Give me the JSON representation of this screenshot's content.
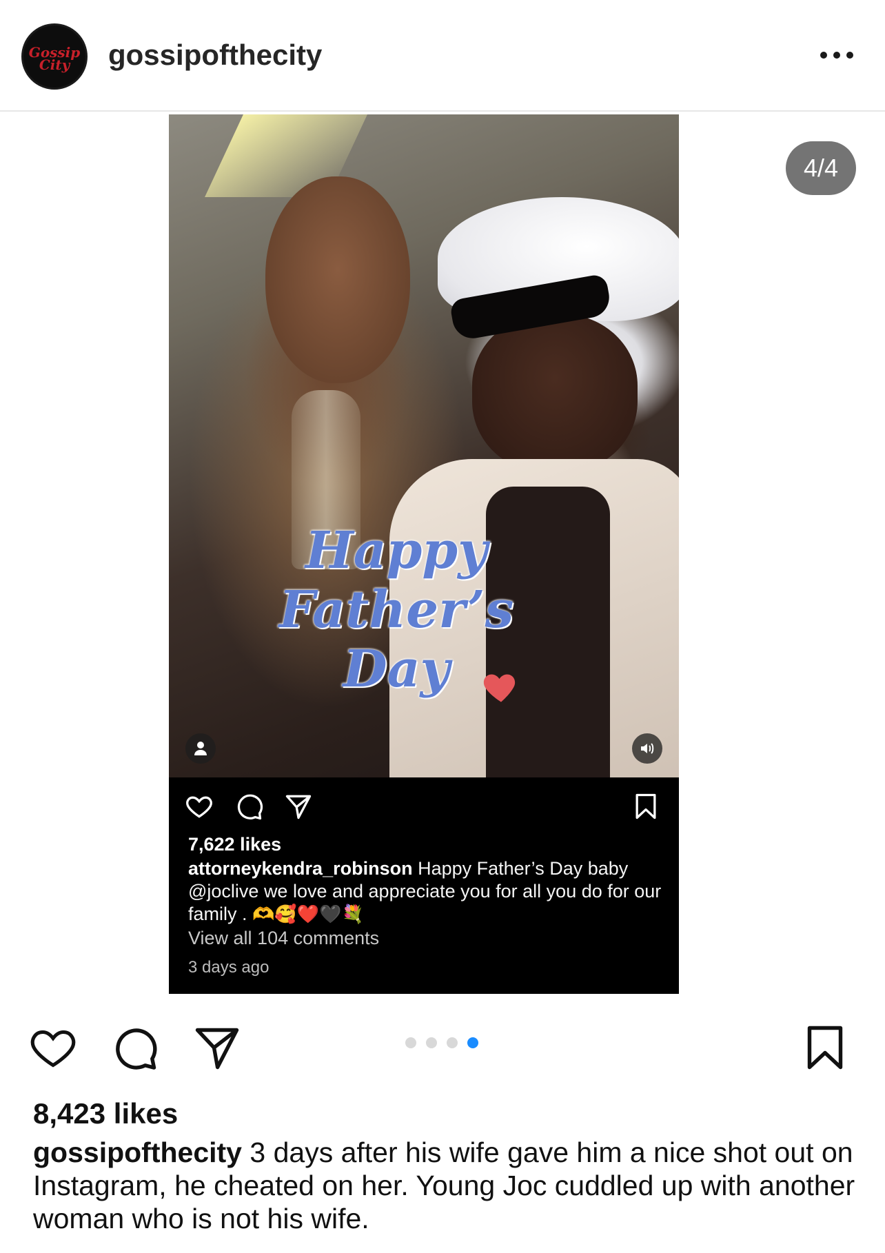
{
  "header": {
    "avatar_text": "Gossip City",
    "username": "gossipofthecity"
  },
  "media": {
    "counter": "4/4",
    "sticker": {
      "line1": "Happy",
      "line2": "Father’s",
      "line3": "Day"
    },
    "inner_post": {
      "likes": "7,622 likes",
      "username": "attorneykendra_robinson",
      "caption_text": "Happy Father’s Day baby @joclive we love and appreciate you  for all you do for our family .",
      "caption_emojis": "🫶🥰❤️🖤💐",
      "view_comments": "View all 104 comments",
      "time": "3 days ago"
    }
  },
  "carousel": {
    "total": 4,
    "active_index": 3
  },
  "post": {
    "likes": "8,423 likes",
    "username": "gossipofthecity",
    "caption": "3 days after his wife gave him a nice shot out on Instagram, he cheated on her. Young Joc cuddled up with another woman who is not his wife."
  },
  "colors": {
    "sticker_text": "#5f7fd3",
    "active_dot": "#1a8cff",
    "inactive_dot": "#d8d8d8",
    "logo_red": "#c8202a"
  }
}
